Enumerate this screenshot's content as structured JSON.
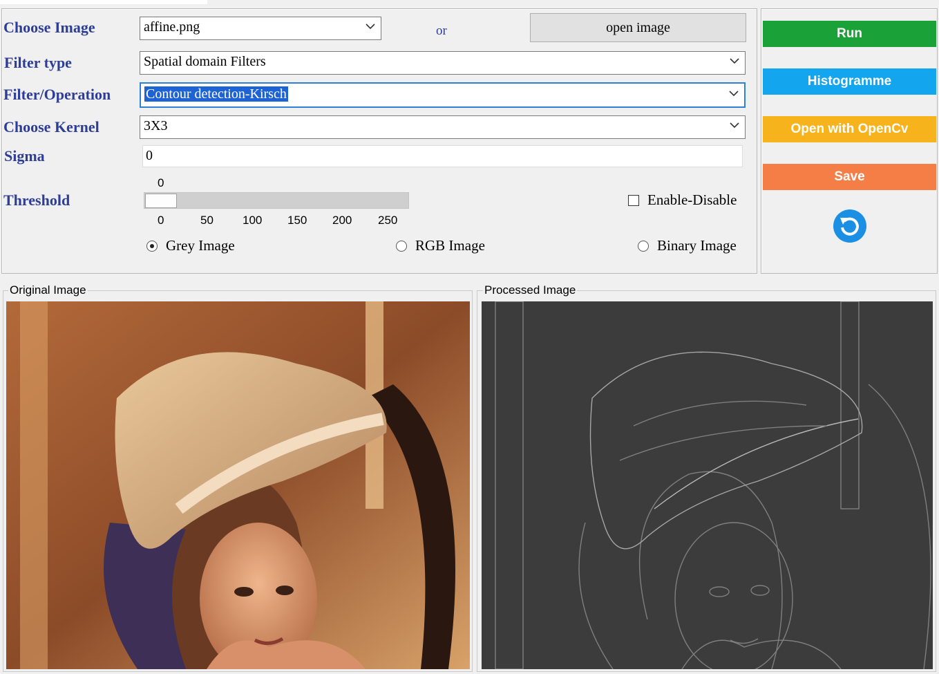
{
  "form": {
    "choose_image_label": "Choose Image",
    "choose_image_value": "affine.png",
    "or_text": "or",
    "open_image_label": "open image",
    "filter_type_label": "Filter type",
    "filter_type_value": "Spatial domain Filters",
    "filter_operation_label": "Filter/Operation",
    "filter_operation_value": "Contour detection-Kirsch",
    "choose_kernel_label": "Choose Kernel",
    "choose_kernel_value": "3X3",
    "sigma_label": "Sigma",
    "sigma_value": "0",
    "threshold_label": "Threshold",
    "threshold_value": 0,
    "threshold_current": "0",
    "threshold_ticks": [
      "0",
      "50",
      "100",
      "150",
      "200",
      "250"
    ],
    "threshold_max": 255,
    "enable_disable_label": "Enable-Disable",
    "enable_disable_checked": false,
    "mode_options": [
      {
        "label": "Grey Image",
        "selected": true
      },
      {
        "label": "RGB Image",
        "selected": false
      },
      {
        "label": "Binary Image",
        "selected": false
      }
    ]
  },
  "actions": {
    "run_label": "Run",
    "histogram_label": "Histogramme",
    "opencv_label": "Open with OpenCv",
    "save_label": "Save",
    "refresh_icon": "refresh-icon"
  },
  "colors": {
    "run": "#1aa138",
    "histogram": "#13a5ee",
    "opencv": "#f6b31b",
    "save": "#f47e46",
    "label_text": "#2e3d96"
  },
  "images": {
    "original_title": "Original Image",
    "processed_title": "Processed Image"
  }
}
